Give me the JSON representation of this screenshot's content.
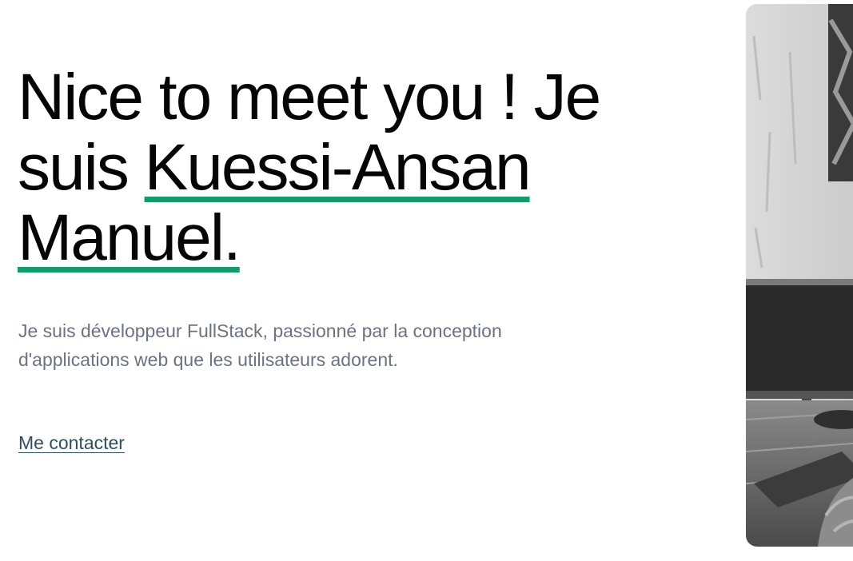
{
  "hero": {
    "headline_part1": "Nice to meet you ! Je suis ",
    "headline_name": "Kuessi-Ansan Manuel.",
    "intro": "Je suis développeur FullStack, passionné par la conception d'applications web que les utilisateurs adorent.",
    "contact_label": "Me contacter"
  },
  "colors": {
    "accent_underline": "#149a6c",
    "heading_text": "#050505",
    "body_text": "#6b7280",
    "link_text": "#2f4f5f"
  },
  "icons": {
    "portrait": "portrait-photo"
  }
}
